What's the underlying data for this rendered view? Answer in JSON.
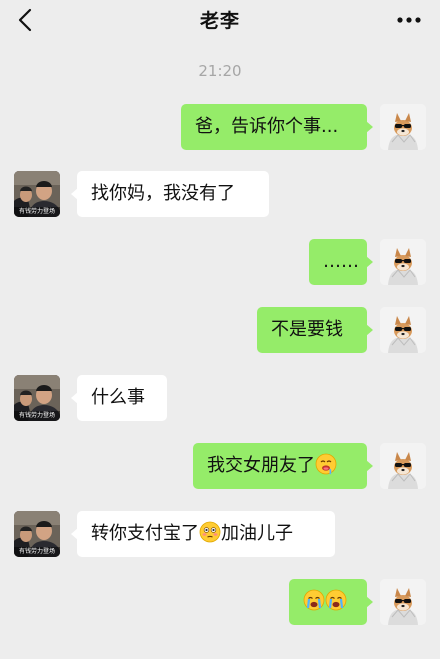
{
  "header": {
    "title": "老李",
    "back_icon": "chevron-left-icon",
    "more_icon": "more-dots-icon"
  },
  "timestamp": "21:20",
  "colors": {
    "background": "#ededed",
    "outgoing_bubble": "#95ec69",
    "incoming_bubble": "#ffffff"
  },
  "avatars": {
    "contact_caption": "有钱劳力登场",
    "self_icon": "sunglasses-dog-avatar"
  },
  "messages": [
    {
      "side": "right",
      "text": "爸，告诉你个事..."
    },
    {
      "side": "left",
      "text": "找你妈，我没有了"
    },
    {
      "side": "right",
      "text": "……"
    },
    {
      "side": "right",
      "text": "不是要钱"
    },
    {
      "side": "left",
      "text": "什么事"
    },
    {
      "side": "right",
      "text": "我交女朋友了",
      "emoji": "drooling-face-icon"
    },
    {
      "side": "left",
      "text_before": "转你支付宝了",
      "emoji": "flushed-face-icon",
      "text_after": "加油儿子"
    },
    {
      "side": "right",
      "emojis": [
        "loudly-crying-face-icon",
        "loudly-crying-face-icon"
      ]
    }
  ]
}
